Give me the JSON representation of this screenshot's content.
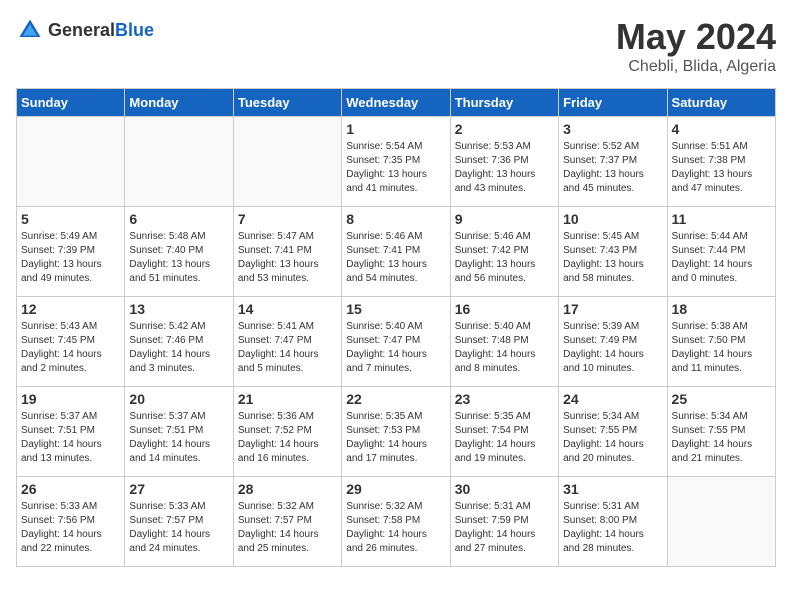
{
  "header": {
    "logo_general": "General",
    "logo_blue": "Blue",
    "month_year": "May 2024",
    "location": "Chebli, Blida, Algeria"
  },
  "days_of_week": [
    "Sunday",
    "Monday",
    "Tuesday",
    "Wednesday",
    "Thursday",
    "Friday",
    "Saturday"
  ],
  "weeks": [
    [
      {
        "day": "",
        "sunrise": "",
        "sunset": "",
        "daylight": "",
        "empty": true
      },
      {
        "day": "",
        "sunrise": "",
        "sunset": "",
        "daylight": "",
        "empty": true
      },
      {
        "day": "",
        "sunrise": "",
        "sunset": "",
        "daylight": "",
        "empty": true
      },
      {
        "day": "1",
        "sunrise": "Sunrise: 5:54 AM",
        "sunset": "Sunset: 7:35 PM",
        "daylight": "Daylight: 13 hours and 41 minutes.",
        "empty": false
      },
      {
        "day": "2",
        "sunrise": "Sunrise: 5:53 AM",
        "sunset": "Sunset: 7:36 PM",
        "daylight": "Daylight: 13 hours and 43 minutes.",
        "empty": false
      },
      {
        "day": "3",
        "sunrise": "Sunrise: 5:52 AM",
        "sunset": "Sunset: 7:37 PM",
        "daylight": "Daylight: 13 hours and 45 minutes.",
        "empty": false
      },
      {
        "day": "4",
        "sunrise": "Sunrise: 5:51 AM",
        "sunset": "Sunset: 7:38 PM",
        "daylight": "Daylight: 13 hours and 47 minutes.",
        "empty": false
      }
    ],
    [
      {
        "day": "5",
        "sunrise": "Sunrise: 5:49 AM",
        "sunset": "Sunset: 7:39 PM",
        "daylight": "Daylight: 13 hours and 49 minutes.",
        "empty": false
      },
      {
        "day": "6",
        "sunrise": "Sunrise: 5:48 AM",
        "sunset": "Sunset: 7:40 PM",
        "daylight": "Daylight: 13 hours and 51 minutes.",
        "empty": false
      },
      {
        "day": "7",
        "sunrise": "Sunrise: 5:47 AM",
        "sunset": "Sunset: 7:41 PM",
        "daylight": "Daylight: 13 hours and 53 minutes.",
        "empty": false
      },
      {
        "day": "8",
        "sunrise": "Sunrise: 5:46 AM",
        "sunset": "Sunset: 7:41 PM",
        "daylight": "Daylight: 13 hours and 54 minutes.",
        "empty": false
      },
      {
        "day": "9",
        "sunrise": "Sunrise: 5:46 AM",
        "sunset": "Sunset: 7:42 PM",
        "daylight": "Daylight: 13 hours and 56 minutes.",
        "empty": false
      },
      {
        "day": "10",
        "sunrise": "Sunrise: 5:45 AM",
        "sunset": "Sunset: 7:43 PM",
        "daylight": "Daylight: 13 hours and 58 minutes.",
        "empty": false
      },
      {
        "day": "11",
        "sunrise": "Sunrise: 5:44 AM",
        "sunset": "Sunset: 7:44 PM",
        "daylight": "Daylight: 14 hours and 0 minutes.",
        "empty": false
      }
    ],
    [
      {
        "day": "12",
        "sunrise": "Sunrise: 5:43 AM",
        "sunset": "Sunset: 7:45 PM",
        "daylight": "Daylight: 14 hours and 2 minutes.",
        "empty": false
      },
      {
        "day": "13",
        "sunrise": "Sunrise: 5:42 AM",
        "sunset": "Sunset: 7:46 PM",
        "daylight": "Daylight: 14 hours and 3 minutes.",
        "empty": false
      },
      {
        "day": "14",
        "sunrise": "Sunrise: 5:41 AM",
        "sunset": "Sunset: 7:47 PM",
        "daylight": "Daylight: 14 hours and 5 minutes.",
        "empty": false
      },
      {
        "day": "15",
        "sunrise": "Sunrise: 5:40 AM",
        "sunset": "Sunset: 7:47 PM",
        "daylight": "Daylight: 14 hours and 7 minutes.",
        "empty": false
      },
      {
        "day": "16",
        "sunrise": "Sunrise: 5:40 AM",
        "sunset": "Sunset: 7:48 PM",
        "daylight": "Daylight: 14 hours and 8 minutes.",
        "empty": false
      },
      {
        "day": "17",
        "sunrise": "Sunrise: 5:39 AM",
        "sunset": "Sunset: 7:49 PM",
        "daylight": "Daylight: 14 hours and 10 minutes.",
        "empty": false
      },
      {
        "day": "18",
        "sunrise": "Sunrise: 5:38 AM",
        "sunset": "Sunset: 7:50 PM",
        "daylight": "Daylight: 14 hours and 11 minutes.",
        "empty": false
      }
    ],
    [
      {
        "day": "19",
        "sunrise": "Sunrise: 5:37 AM",
        "sunset": "Sunset: 7:51 PM",
        "daylight": "Daylight: 14 hours and 13 minutes.",
        "empty": false
      },
      {
        "day": "20",
        "sunrise": "Sunrise: 5:37 AM",
        "sunset": "Sunset: 7:51 PM",
        "daylight": "Daylight: 14 hours and 14 minutes.",
        "empty": false
      },
      {
        "day": "21",
        "sunrise": "Sunrise: 5:36 AM",
        "sunset": "Sunset: 7:52 PM",
        "daylight": "Daylight: 14 hours and 16 minutes.",
        "empty": false
      },
      {
        "day": "22",
        "sunrise": "Sunrise: 5:35 AM",
        "sunset": "Sunset: 7:53 PM",
        "daylight": "Daylight: 14 hours and 17 minutes.",
        "empty": false
      },
      {
        "day": "23",
        "sunrise": "Sunrise: 5:35 AM",
        "sunset": "Sunset: 7:54 PM",
        "daylight": "Daylight: 14 hours and 19 minutes.",
        "empty": false
      },
      {
        "day": "24",
        "sunrise": "Sunrise: 5:34 AM",
        "sunset": "Sunset: 7:55 PM",
        "daylight": "Daylight: 14 hours and 20 minutes.",
        "empty": false
      },
      {
        "day": "25",
        "sunrise": "Sunrise: 5:34 AM",
        "sunset": "Sunset: 7:55 PM",
        "daylight": "Daylight: 14 hours and 21 minutes.",
        "empty": false
      }
    ],
    [
      {
        "day": "26",
        "sunrise": "Sunrise: 5:33 AM",
        "sunset": "Sunset: 7:56 PM",
        "daylight": "Daylight: 14 hours and 22 minutes.",
        "empty": false
      },
      {
        "day": "27",
        "sunrise": "Sunrise: 5:33 AM",
        "sunset": "Sunset: 7:57 PM",
        "daylight": "Daylight: 14 hours and 24 minutes.",
        "empty": false
      },
      {
        "day": "28",
        "sunrise": "Sunrise: 5:32 AM",
        "sunset": "Sunset: 7:57 PM",
        "daylight": "Daylight: 14 hours and 25 minutes.",
        "empty": false
      },
      {
        "day": "29",
        "sunrise": "Sunrise: 5:32 AM",
        "sunset": "Sunset: 7:58 PM",
        "daylight": "Daylight: 14 hours and 26 minutes.",
        "empty": false
      },
      {
        "day": "30",
        "sunrise": "Sunrise: 5:31 AM",
        "sunset": "Sunset: 7:59 PM",
        "daylight": "Daylight: 14 hours and 27 minutes.",
        "empty": false
      },
      {
        "day": "31",
        "sunrise": "Sunrise: 5:31 AM",
        "sunset": "Sunset: 8:00 PM",
        "daylight": "Daylight: 14 hours and 28 minutes.",
        "empty": false
      },
      {
        "day": "",
        "sunrise": "",
        "sunset": "",
        "daylight": "",
        "empty": true
      }
    ]
  ]
}
